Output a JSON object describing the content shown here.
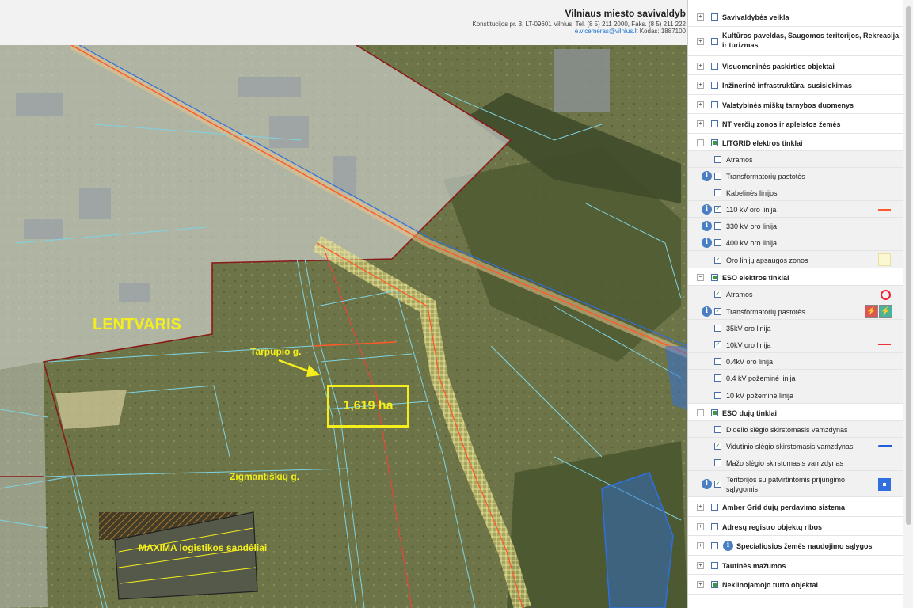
{
  "header": {
    "org": "Vilniaus miesto savivaldyb",
    "address": "Konstitucijos pr. 3, LT-09601 Vilnius, Tel. (8 5) 211 2000, Faks. (8 5) 211 222",
    "email": "e.vicemeras@vilnius.lt",
    "code": "Kodas: 1887100"
  },
  "map": {
    "labels": {
      "city": "LENTVARIS",
      "street1": "Tarpupio g.",
      "street2": "Zigmantiškių g.",
      "warehouse": "MAXIMA logistikos sandėliai",
      "area": "1,619 ha"
    },
    "colors": {
      "highlight": "#f4ef1c",
      "parcel_lines": "#7fd3e3",
      "boundary": "#8a1a1a",
      "power_line": "#ff5a2a",
      "gas_line": "#2f6fe0"
    }
  },
  "layers": {
    "items": [
      {
        "label": "Savivaldybės veikla",
        "type": "group",
        "checked": false
      },
      {
        "label": "Kultūros paveldas, Saugomos teritorijos, Rekreacija ir turizmas",
        "type": "group",
        "checked": false
      },
      {
        "label": "Visuomeninės paskirties objektai",
        "type": "group",
        "checked": false
      },
      {
        "label": "Inžinerinė infrastruktūra, susisiekimas",
        "type": "group",
        "checked": false
      },
      {
        "label": "Valstybinės miškų tarnybos duomenys",
        "type": "group",
        "checked": false
      },
      {
        "label": "NT verčių zonos ir apleistos žemės",
        "type": "group",
        "checked": false
      },
      {
        "label": "LITGRID elektros tinklai",
        "type": "group",
        "checked": "partial",
        "expanded": true
      },
      {
        "label": "Atramos",
        "type": "sub",
        "checked": false
      },
      {
        "label": "Transformatorių pastotės",
        "type": "sub",
        "checked": false,
        "info": true
      },
      {
        "label": "Kabelinės linijos",
        "type": "sub",
        "checked": false
      },
      {
        "label": "110 kV oro linija",
        "type": "sub",
        "checked": true,
        "info": true,
        "legend": "red-line"
      },
      {
        "label": "330 kV oro linija",
        "type": "sub",
        "checked": false,
        "info": true
      },
      {
        "label": "400 kV oro linija",
        "type": "sub",
        "checked": false,
        "info": true
      },
      {
        "label": "Oro linijų apsaugos zonos",
        "type": "sub",
        "checked": true,
        "legend": "yellow-box"
      },
      {
        "label": "ESO elektros tinklai",
        "type": "group",
        "checked": "partial",
        "expanded": true
      },
      {
        "label": "Atramos",
        "type": "sub",
        "checked": true,
        "legend": "red-circle"
      },
      {
        "label": "Transformatorių pastotės",
        "type": "sub",
        "checked": true,
        "info": true,
        "legend": "substation-icons"
      },
      {
        "label": "35kV oro linija",
        "type": "sub",
        "checked": false
      },
      {
        "label": "10kV oro linija",
        "type": "sub",
        "checked": true,
        "legend": "red-thin-line"
      },
      {
        "label": "0.4kV oro linija",
        "type": "sub",
        "checked": false
      },
      {
        "label": "0.4 kV požeminė linija",
        "type": "sub",
        "checked": false
      },
      {
        "label": "10 kV požeminė linija",
        "type": "sub",
        "checked": false
      },
      {
        "label": "ESO dujų tinklai",
        "type": "group",
        "checked": "partial",
        "expanded": true
      },
      {
        "label": "Didelio slėgio skirstomasis vamzdynas",
        "type": "sub",
        "checked": false
      },
      {
        "label": "Vidutinio slėgio skirstomasis vamzdynas",
        "type": "sub",
        "checked": true,
        "legend": "blue-line"
      },
      {
        "label": "Mažo slėgio skirstomasis vamzdynas",
        "type": "sub",
        "checked": false
      },
      {
        "label": "Teritorijos su patvirtintomis prijungimo sąlygomis",
        "type": "sub",
        "checked": true,
        "info": true,
        "legend": "blue-square"
      },
      {
        "label": "Amber Grid dujų perdavimo sistema",
        "type": "group",
        "checked": false
      },
      {
        "label": "Adresų registro objektų ribos",
        "type": "group",
        "checked": false
      },
      {
        "label": "Specialiosios žemės naudojimo sąlygos",
        "type": "group",
        "checked": false,
        "info": true
      },
      {
        "label": "Tautinės mažumos",
        "type": "group",
        "checked": false
      },
      {
        "label": "Nekilnojamojo turto objektai",
        "type": "group",
        "checked": "partial"
      }
    ]
  }
}
